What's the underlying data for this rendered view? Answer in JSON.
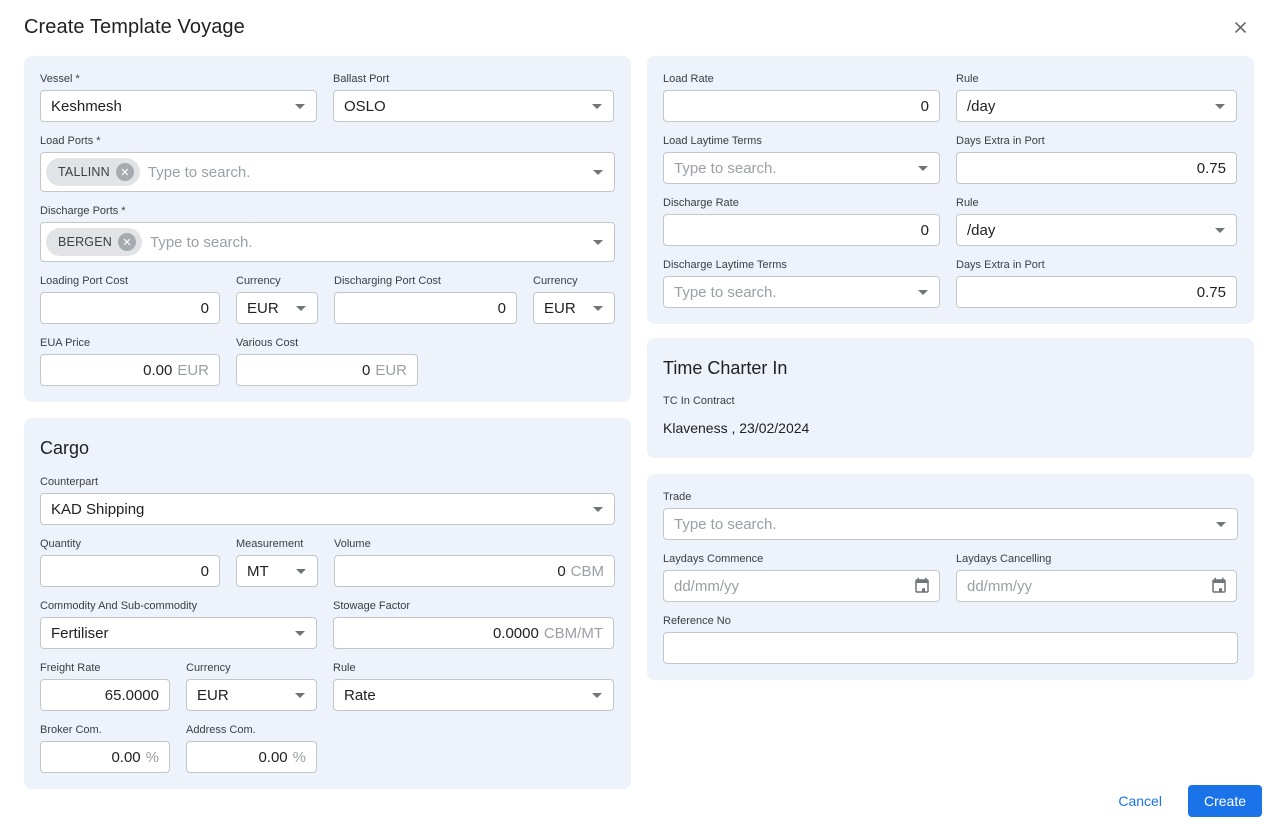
{
  "dialog": {
    "title": "Create Template Voyage"
  },
  "colors": {
    "accent_blue": "#1A73E8",
    "panel_bg": "#EDF2FB",
    "chip_bg": "#E1E3E6"
  },
  "icons": {
    "close": "close-icon",
    "dropdown": "dropdown-arrow-icon",
    "calendar": "calendar-icon",
    "chip_delete": "chip-delete-icon"
  },
  "panels": {
    "voyage": {
      "vessel": {
        "label": "Vessel *",
        "value": "Keshmesh"
      },
      "ballast_port": {
        "label": "Ballast Port",
        "value": "OSLO"
      },
      "load_ports": {
        "label": "Load Ports *",
        "chip": "TALLINN",
        "placeholder": "Type to search."
      },
      "discharge_ports": {
        "label": "Discharge Ports *",
        "chip": "BERGEN",
        "placeholder": "Type to search."
      },
      "loading_port_cost": {
        "label": "Loading Port Cost",
        "value": "0"
      },
      "loading_currency": {
        "label": "Currency",
        "value": "EUR"
      },
      "discharging_port_cost": {
        "label": "Discharging Port Cost",
        "value": "0"
      },
      "discharging_currency": {
        "label": "Currency",
        "value": "EUR"
      },
      "eua_price": {
        "label": "EUA Price",
        "value": "0.00",
        "suffix": "EUR"
      },
      "various_cost": {
        "label": "Various Cost",
        "value": "0",
        "suffix": "EUR"
      }
    },
    "cargo": {
      "heading": "Cargo",
      "counterpart": {
        "label": "Counterpart",
        "value": "KAD Shipping"
      },
      "quantity": {
        "label": "Quantity",
        "value": "0"
      },
      "measurement": {
        "label": "Measurement",
        "value": "MT"
      },
      "volume": {
        "label": "Volume",
        "value": "0",
        "suffix": "CBM"
      },
      "commodity": {
        "label": "Commodity And Sub-commodity",
        "value": "Fertiliser"
      },
      "stowage_factor": {
        "label": "Stowage Factor",
        "value": "0.0000",
        "suffix": "CBM/MT"
      },
      "freight_rate": {
        "label": "Freight Rate",
        "value": "65.0000"
      },
      "freight_currency": {
        "label": "Currency",
        "value": "EUR"
      },
      "freight_rule": {
        "label": "Rule",
        "value": "Rate"
      },
      "broker_com": {
        "label": "Broker Com.",
        "value": "0.00",
        "suffix": "%"
      },
      "address_com": {
        "label": "Address Com.",
        "value": "0.00",
        "suffix": "%"
      }
    },
    "laytime": {
      "load_rate": {
        "label": "Load Rate",
        "value": "0"
      },
      "load_rule": {
        "label": "Rule",
        "value": "/day"
      },
      "load_laytime_terms": {
        "label": "Load Laytime Terms",
        "placeholder": "Type to search."
      },
      "load_days_extra": {
        "label": "Days Extra in Port",
        "value": "0.75"
      },
      "discharge_rate": {
        "label": "Discharge Rate",
        "value": "0"
      },
      "discharge_rule": {
        "label": "Rule",
        "value": "/day"
      },
      "discharge_laytime_terms": {
        "label": "Discharge Laytime Terms",
        "placeholder": "Type to search."
      },
      "discharge_days_extra": {
        "label": "Days Extra in Port",
        "value": "0.75"
      }
    },
    "time_charter_in": {
      "heading": "Time Charter In",
      "contract_label": "TC In Contract",
      "contract_value": "Klaveness , 23/02/2024"
    },
    "trade": {
      "trade": {
        "label": "Trade",
        "placeholder": "Type to search."
      },
      "laydays_commence": {
        "label": "Laydays Commence",
        "placeholder": "dd/mm/yy"
      },
      "laydays_cancelling": {
        "label": "Laydays Cancelling",
        "placeholder": "dd/mm/yy"
      },
      "reference_no": {
        "label": "Reference No",
        "value": ""
      }
    }
  },
  "footer": {
    "cancel_label": "Cancel",
    "create_label": "Create"
  }
}
